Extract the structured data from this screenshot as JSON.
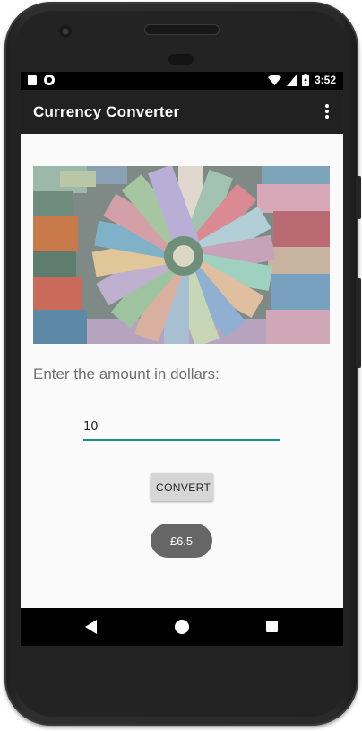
{
  "status_bar": {
    "time": "3:52",
    "icons": [
      "sd-card-icon",
      "sync-icon",
      "wifi-icon",
      "cell-signal-icon",
      "battery-charging-icon"
    ]
  },
  "app_bar": {
    "title": "Currency Converter",
    "overflow_icon": "more-vert-icon"
  },
  "main": {
    "banner_image": "currency-banknotes-collage",
    "instruction": "Enter the amount in dollars:",
    "amount_value": "10",
    "convert_label": "CONVERT",
    "result": "£6.5"
  },
  "nav_bar": {
    "icons": [
      "back-icon",
      "home-icon",
      "recents-icon"
    ]
  },
  "colors": {
    "app_bar": "#212121",
    "accent": "#1e8f84",
    "toast": "#666666",
    "button": "#d6d6d6"
  }
}
